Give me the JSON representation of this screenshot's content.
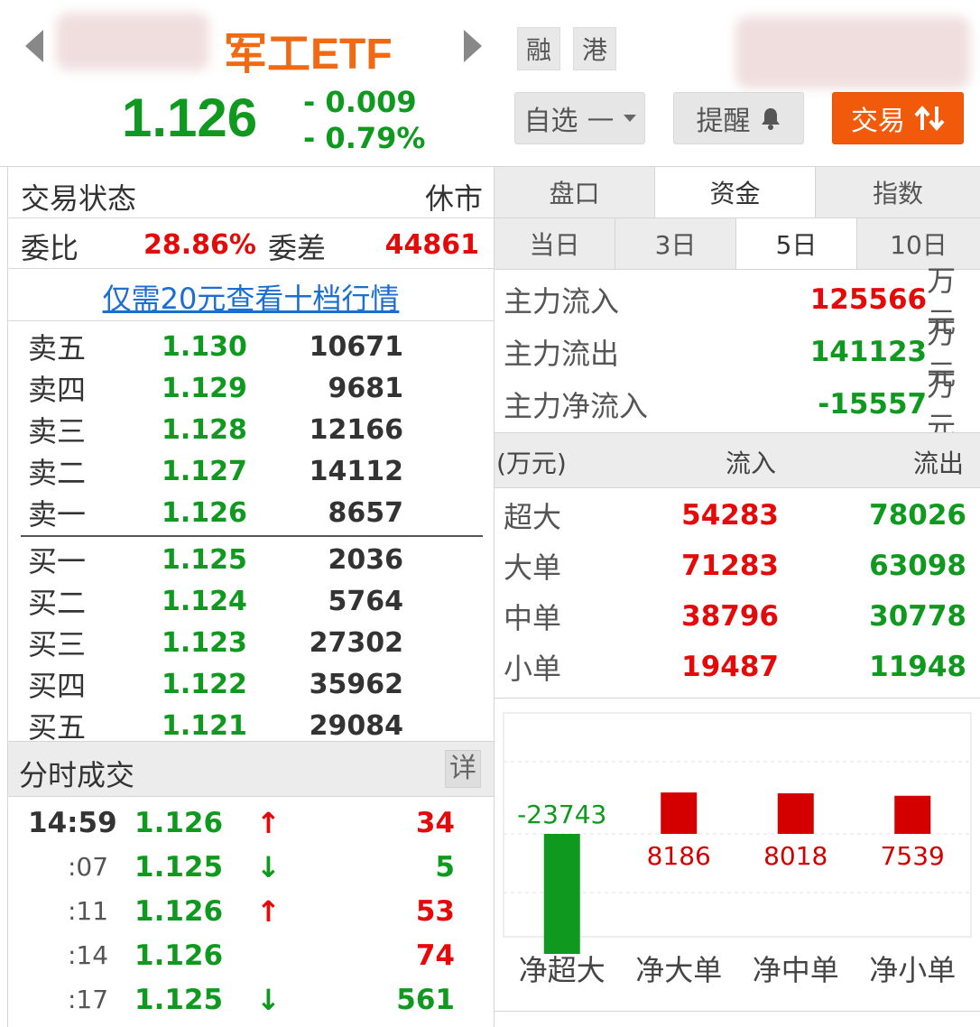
{
  "header": {
    "title": "军工ETF",
    "price": "1.126",
    "change": "- 0.009",
    "change_pct": "- 0.79%",
    "tag_margin": "融",
    "tag_hk": "港",
    "watchlist_button": "自选",
    "watchlist_dash": "—",
    "alert_button": "提醒",
    "trade_button": "交易"
  },
  "status": {
    "label": "交易状态",
    "value": "休市"
  },
  "committee": {
    "ratio_label": "委比",
    "ratio_value": "28.86%",
    "diff_label": "委差",
    "diff_value": "44861"
  },
  "promo_link": "仅需20元查看十档行情",
  "order_book": {
    "asks": [
      {
        "name": "卖五",
        "price": "1.130",
        "volume": "10671"
      },
      {
        "name": "卖四",
        "price": "1.129",
        "volume": "9681"
      },
      {
        "name": "卖三",
        "price": "1.128",
        "volume": "12166"
      },
      {
        "name": "卖二",
        "price": "1.127",
        "volume": "14112"
      },
      {
        "name": "卖一",
        "price": "1.126",
        "volume": "8657"
      }
    ],
    "bids": [
      {
        "name": "买一",
        "price": "1.125",
        "volume": "2036"
      },
      {
        "name": "买二",
        "price": "1.124",
        "volume": "5764"
      },
      {
        "name": "买三",
        "price": "1.123",
        "volume": "27302"
      },
      {
        "name": "买四",
        "price": "1.122",
        "volume": "35962"
      },
      {
        "name": "买五",
        "price": "1.121",
        "volume": "29084"
      }
    ]
  },
  "ticks": {
    "title": "分时成交",
    "detail_button": "详",
    "rows": [
      {
        "time": "14:59",
        "price": "1.126",
        "dir": "↑",
        "volume": "34"
      },
      {
        "time": ":07",
        "price": "1.125",
        "dir": "↓",
        "volume": "5"
      },
      {
        "time": ":11",
        "price": "1.126",
        "dir": "↑",
        "volume": "53"
      },
      {
        "time": ":14",
        "price": "1.126",
        "dir": "",
        "volume": "74"
      },
      {
        "time": ":17",
        "price": "1.125",
        "dir": "↓",
        "volume": "561"
      }
    ]
  },
  "tabs": {
    "main": [
      "盘口",
      "资金",
      "指数"
    ],
    "main_active": 1,
    "period": [
      "当日",
      "3日",
      "5日",
      "10日"
    ],
    "period_active": 2
  },
  "fund_flow": {
    "unit": "万元",
    "inflow_label": "主力流入",
    "inflow_value": "125566",
    "outflow_label": "主力流出",
    "outflow_value": "141123",
    "net_label": "主力净流入",
    "net_value": "-15557"
  },
  "size_table": {
    "header_unit": "(万元)",
    "header_in": "流入",
    "header_out": "流出",
    "rows": [
      {
        "name": "超大",
        "in": "54283",
        "out": "78026"
      },
      {
        "name": "大单",
        "in": "71283",
        "out": "63098"
      },
      {
        "name": "中单",
        "in": "38796",
        "out": "30778"
      },
      {
        "name": "小单",
        "in": "19487",
        "out": "11948"
      }
    ]
  },
  "chart_data": {
    "type": "bar",
    "categories": [
      "净超大",
      "净大单",
      "净中单",
      "净小单"
    ],
    "values": [
      -23743,
      8186,
      8018,
      7539
    ],
    "labels": [
      "-23743",
      "8186",
      "8018",
      "7539"
    ],
    "positive_color": "#d40000",
    "negative_color": "#0f9a1f",
    "title": "",
    "xlabel": "",
    "ylabel": "",
    "grid": true
  },
  "colors": {
    "up": "#e40a0a",
    "down": "#0f9a1f",
    "title": "#f06a14",
    "trade_button": "#f05a0a",
    "link": "#1a6fd0"
  }
}
